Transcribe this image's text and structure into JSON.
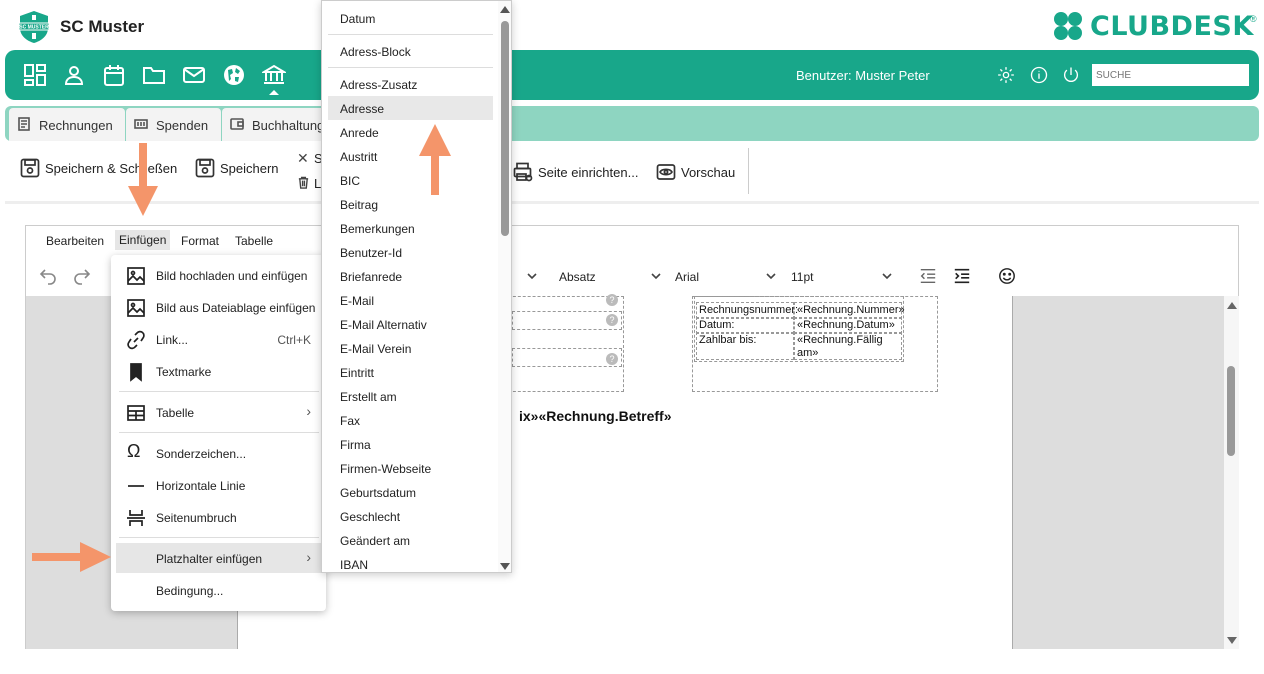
{
  "header": {
    "club_name": "SC Muster",
    "brand_logo_text": "SC MUSTER",
    "app_brand": "CLUBDESK",
    "registered_mark": "®"
  },
  "navbar": {
    "icons": [
      "dashboard-icon",
      "person-icon",
      "calendar-icon",
      "folder-icon",
      "mail-icon",
      "globe-icon",
      "bank-icon"
    ],
    "user_label": "Benutzer: Muster Peter",
    "search_placeholder": "SUCHE"
  },
  "tabs": [
    {
      "label": "Rechnungen",
      "icon": "invoice-icon"
    },
    {
      "label": "Spenden",
      "icon": "donation-icon"
    },
    {
      "label": "Buchhaltung",
      "icon": "wallet-icon"
    }
  ],
  "toolbar": {
    "save_close": "Speichern & Schließen",
    "save": "Speichern",
    "cut_label": "S",
    "delete_label": "L",
    "page_setup": "Seite einrichten...",
    "preview": "Vorschau"
  },
  "editor": {
    "menubar": [
      "Bearbeiten",
      "Einfügen",
      "Format",
      "Tabelle"
    ],
    "block_format": "Absatz",
    "font_family": "Arial",
    "font_size": "11pt"
  },
  "document": {
    "rows": [
      {
        "label": "Rechnungsnummer:",
        "value": "«Rechnung.Nummer»"
      },
      {
        "label": "Datum:",
        "value": "«Rechnung.Datum»"
      },
      {
        "label": "Zahlbar bis:",
        "value": "«Rechnung.Fällig am»"
      }
    ],
    "betreff": "ix»«Rechnung.Betreff»",
    "question_mark": "?"
  },
  "insert_menu": {
    "items": [
      {
        "label": "Bild hochladen und einfügen",
        "shortcut": ""
      },
      {
        "label": "Bild aus Dateiablage einfügen",
        "shortcut": ""
      },
      {
        "label": "Link...",
        "shortcut": "Ctrl+K"
      },
      {
        "label": "Textmarke",
        "shortcut": ""
      },
      {
        "label": "Tabelle",
        "shortcut": ""
      },
      {
        "label": "Sonderzeichen...",
        "shortcut": ""
      },
      {
        "label": "Horizontale Linie",
        "shortcut": ""
      },
      {
        "label": "Seitenumbruch",
        "shortcut": ""
      },
      {
        "label": "Platzhalter einfügen",
        "shortcut": ""
      },
      {
        "label": "Bedingung...",
        "shortcut": ""
      }
    ]
  },
  "placeholder_menu": {
    "items": [
      "Datum",
      "Adress-Block",
      "Adress-Zusatz",
      "Adresse",
      "Anrede",
      "Austritt",
      "BIC",
      "Beitrag",
      "Bemerkungen",
      "Benutzer-Id",
      "Briefanrede",
      "E-Mail",
      "E-Mail Alternativ",
      "E-Mail Verein",
      "Eintritt",
      "Erstellt am",
      "Fax",
      "Firma",
      "Firmen-Webseite",
      "Geburtsdatum",
      "Geschlecht",
      "Geändert am",
      "IBAN"
    ],
    "highlighted": "Adresse"
  },
  "colors": {
    "brand": "#18a78a",
    "tabbar": "#8ed5c1",
    "arrow": "#f4956a"
  }
}
